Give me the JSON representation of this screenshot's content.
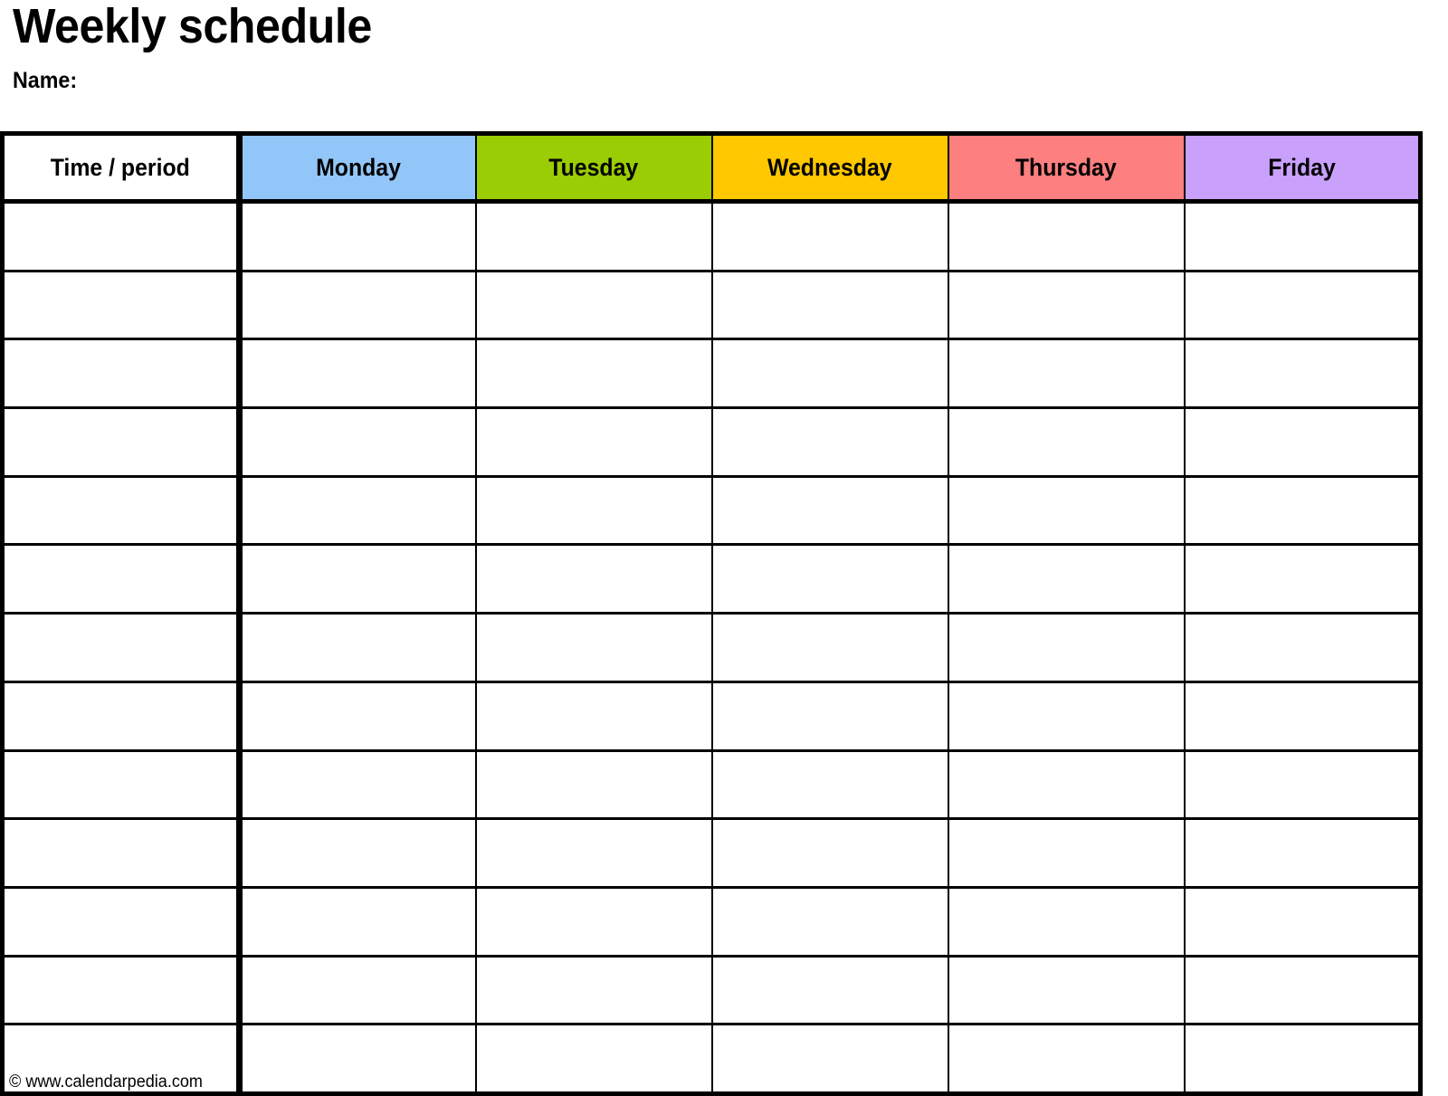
{
  "document": {
    "title": "Weekly schedule",
    "name_label": "Name:"
  },
  "table": {
    "columns": [
      {
        "label": "Time / period",
        "color": "#FFFFFF",
        "key": "time"
      },
      {
        "label": "Monday",
        "color": "#93C6F8",
        "key": "monday"
      },
      {
        "label": "Tuesday",
        "color": "#9ACD04",
        "key": "tuesday"
      },
      {
        "label": "Wednesday",
        "color": "#FFC800",
        "key": "wednesday"
      },
      {
        "label": "Thursday",
        "color": "#FD7F7F",
        "key": "thursday"
      },
      {
        "label": "Friday",
        "color": "#C9A0FC",
        "key": "friday"
      }
    ],
    "row_count": 13,
    "rows": [
      {
        "time": "",
        "monday": "",
        "tuesday": "",
        "wednesday": "",
        "thursday": "",
        "friday": ""
      },
      {
        "time": "",
        "monday": "",
        "tuesday": "",
        "wednesday": "",
        "thursday": "",
        "friday": ""
      },
      {
        "time": "",
        "monday": "",
        "tuesday": "",
        "wednesday": "",
        "thursday": "",
        "friday": ""
      },
      {
        "time": "",
        "monday": "",
        "tuesday": "",
        "wednesday": "",
        "thursday": "",
        "friday": ""
      },
      {
        "time": "",
        "monday": "",
        "tuesday": "",
        "wednesday": "",
        "thursday": "",
        "friday": ""
      },
      {
        "time": "",
        "monday": "",
        "tuesday": "",
        "wednesday": "",
        "thursday": "",
        "friday": ""
      },
      {
        "time": "",
        "monday": "",
        "tuesday": "",
        "wednesday": "",
        "thursday": "",
        "friday": ""
      },
      {
        "time": "",
        "monday": "",
        "tuesday": "",
        "wednesday": "",
        "thursday": "",
        "friday": ""
      },
      {
        "time": "",
        "monday": "",
        "tuesday": "",
        "wednesday": "",
        "thursday": "",
        "friday": ""
      },
      {
        "time": "",
        "monday": "",
        "tuesday": "",
        "wednesday": "",
        "thursday": "",
        "friday": ""
      },
      {
        "time": "",
        "monday": "",
        "tuesday": "",
        "wednesday": "",
        "thursday": "",
        "friday": ""
      },
      {
        "time": "",
        "monday": "",
        "tuesday": "",
        "wednesday": "",
        "thursday": "",
        "friday": ""
      },
      {
        "time": "",
        "monday": "",
        "tuesday": "",
        "wednesday": "",
        "thursday": "",
        "friday": ""
      }
    ]
  },
  "footer": {
    "credit": "© www.calendarpedia.com"
  }
}
